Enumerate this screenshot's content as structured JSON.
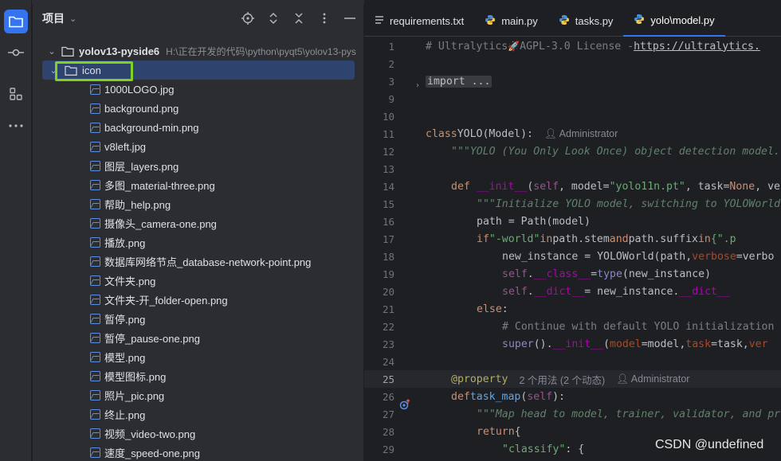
{
  "project_panel": {
    "title": "项目",
    "root": {
      "name": "yolov13-pyside6",
      "path": "H:\\正在开发的代码\\python\\pyqt5\\yolov13-pys"
    },
    "selected_folder": "icon",
    "files": [
      "1000LOGO.jpg",
      "background.png",
      "background-min.png",
      "v8left.jpg",
      "图层_layers.png",
      "多图_material-three.png",
      "帮助_help.png",
      "摄像头_camera-one.png",
      "播放.png",
      "数据库网络节点_database-network-point.png",
      "文件夹.png",
      "文件夹-开_folder-open.png",
      "暂停.png",
      "暂停_pause-one.png",
      "模型.png",
      "模型图标.png",
      "照片_pic.png",
      "终止.png",
      "视频_video-two.png",
      "速度_speed-one.png"
    ]
  },
  "tabs": [
    {
      "label": "requirements.txt",
      "icon": "text-file-icon"
    },
    {
      "label": "main.py",
      "icon": "python-icon"
    },
    {
      "label": "tasks.py",
      "icon": "python-icon"
    },
    {
      "label": "yolo\\model.py",
      "icon": "python-icon",
      "active": true
    }
  ],
  "code": {
    "line_numbers": [
      "1",
      "2",
      "3",
      "9",
      "10",
      "11",
      "12",
      "13",
      "14",
      "15",
      "16",
      "17",
      "18",
      "19",
      "20",
      "21",
      "22",
      "23",
      "24",
      "25",
      "26",
      "27",
      "28",
      "29"
    ],
    "l1_comment": "# Ultralytics ",
    "l1_rocket": "🚀",
    "l1_license": " AGPL-3.0 License - ",
    "l1_link": "https://ultralytics.",
    "l3_import": "import ...",
    "l11_class_kw": "class",
    "l11_class_name": " YOLO(Model):",
    "author_hint": "Administrator",
    "l12_doc": "\"\"\"YOLO (You Only Look Once) object detection model.",
    "l14_def": "def",
    "l14_init": "__init__",
    "l14_open": "(",
    "l14_self": "self",
    "l14_mid": ", model=",
    "l14_str": "\"yolo11n.pt\"",
    "l14_task": ", task=",
    "l14_none": "None",
    "l14_tail": ", ve",
    "l15_doc": "\"\"\"Initialize YOLO model, switching to YOLOWorld",
    "l16": "path = Path(model)",
    "l17_if": "if",
    "l17_str": " \"-world\"",
    "l17_in": " in",
    "l17_mid": " path.stem ",
    "l17_and": "and",
    "l17_mid2": " path.suffix ",
    "l17_in2": "in",
    "l17_tail": " {\".p",
    "l18_a": "new_instance = YOLOWorld(path, ",
    "l18_kw": "verbose",
    "l18_b": "=verbo",
    "l19_self": "self",
    "l19_dot": ".",
    "l19_cls": "__class__",
    "l19_eq": " = ",
    "l19_type": "type",
    "l19_tail": "(new_instance)",
    "l20_self": "self",
    "l20_dot": ".",
    "l20_dict": "__dict__",
    "l20_eq": " = new_instance.",
    "l20_dict2": "__dict__",
    "l21_else": "else",
    "l21_colon": ":",
    "l22_comment": "# Continue with default YOLO initialization",
    "l23_super": "super",
    "l23_a": "().",
    "l23_init": "__init__",
    "l23_open": "(",
    "l23_model": "model",
    "l23_b": "=model, ",
    "l23_task": "task",
    "l23_c": "=task, ",
    "l23_ver": "ver",
    "l25_dec": "@property",
    "l25_usages": "2 个用法 (2 个动态)",
    "l26_def": "def",
    "l26_name": " task_map",
    "l26_open": "(",
    "l26_self": "self",
    "l26_close": "):",
    "l27_doc": "\"\"\"Map head to model, trainer, validator, and pr",
    "l28_return": "return",
    "l28_brace": " {",
    "l29_str": "\"classify\"",
    "l29_tail": ": {"
  },
  "watermark": "CSDN @undefined",
  "colors": {
    "accent": "#3574f0",
    "highlight_box": "#7ed321",
    "selection": "#2e436e"
  }
}
